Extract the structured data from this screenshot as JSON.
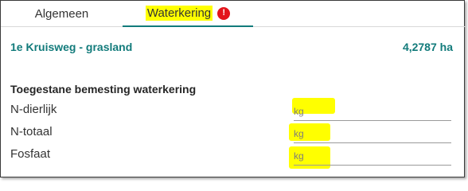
{
  "tabs": {
    "general": "Algemeen",
    "water": "Waterkering",
    "warning_glyph": "!"
  },
  "parcel": {
    "name": "1e Kruisweg - grasland",
    "area": "4,2787 ha"
  },
  "section": {
    "title": "Toegestane bemesting waterkering"
  },
  "fields": [
    {
      "label": "N-dierlijk",
      "placeholder": "kg",
      "value": ""
    },
    {
      "label": "N-totaal",
      "placeholder": "kg",
      "value": ""
    },
    {
      "label": "Fosfaat",
      "placeholder": "kg",
      "value": ""
    }
  ],
  "colors": {
    "accent": "#127b7b",
    "warning": "#e3141b",
    "highlight": "#ffff00"
  },
  "icons": {
    "warning": "exclamation-circle-icon"
  }
}
